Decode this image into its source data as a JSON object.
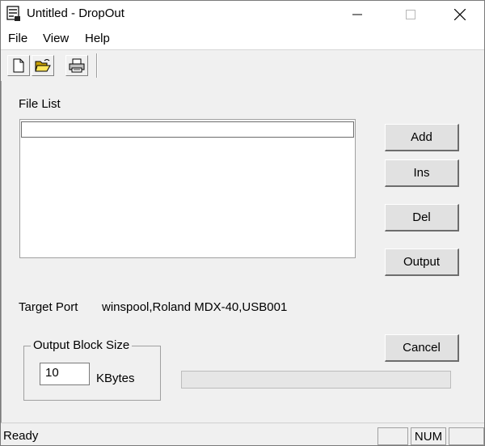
{
  "window": {
    "title": "Untitled - DropOut"
  },
  "menu": {
    "items": [
      "File",
      "View",
      "Help"
    ]
  },
  "toolbar": {
    "buttons": [
      "new-document-icon",
      "open-folder-icon",
      "print-icon"
    ]
  },
  "file_list": {
    "label": "File List",
    "items": [
      ""
    ]
  },
  "buttons": {
    "add": "Add",
    "ins": "Ins",
    "del": "Del",
    "output": "Output",
    "cancel": "Cancel"
  },
  "target_port": {
    "label": "Target Port",
    "value": "winspool,Roland MDX-40,USB001"
  },
  "output_block": {
    "title": "Output Block Size",
    "value": "10",
    "unit": "KBytes"
  },
  "progress": {
    "fraction": 0
  },
  "status": {
    "text": "Ready",
    "panes": [
      "",
      "NUM",
      ""
    ]
  }
}
